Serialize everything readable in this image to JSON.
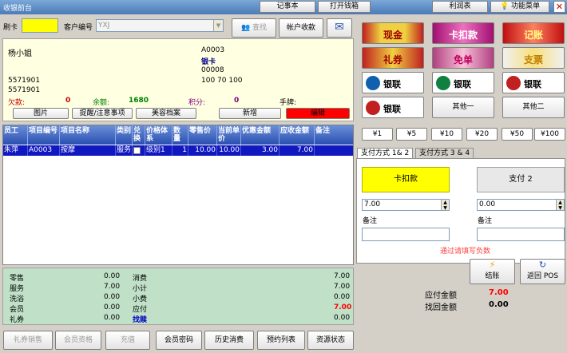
{
  "window": {
    "title": "收银前台"
  },
  "topbar": {
    "notepad": "记事本",
    "open_drawer": "打开钱箱",
    "profit_table": "利润表",
    "function_menu": "功能菜单"
  },
  "card": {
    "label": "刷卡",
    "value": "",
    "customer_label": "客户编号",
    "customer_value": "YXJ",
    "search": "查找",
    "account_pay": "帐户收款"
  },
  "member": {
    "name": "杨小姐",
    "code": "A0003",
    "card_type": "银卡",
    "number": "00008",
    "phone1": "5571901",
    "phone2": "5571901",
    "stats_line": "100   70   100",
    "debt_label": "欠款:",
    "debt_value": "0",
    "balance_label": "余额:",
    "balance_value": "1680",
    "points_label": "积分:",
    "points_value": "0",
    "hand_label": "手牌:",
    "hand_value": ""
  },
  "member_buttons": {
    "photo": "图片",
    "reminder": "提醒/注意事项",
    "beauty": "美容档案",
    "add": "新增",
    "edit": "编辑"
  },
  "table": {
    "headers": [
      "员工",
      "项目编号",
      "项目名称",
      "类别",
      "兑换",
      "价格体系",
      "数量",
      "零售价",
      "当前单价",
      "优惠金额",
      "应收金额",
      "备注"
    ],
    "rows": [
      {
        "employee": "朱萍",
        "code": "A0003",
        "name": "按摩",
        "category": "服务",
        "exchange": "",
        "price_system": "级别1",
        "qty": "1",
        "retail": "10.00",
        "unit": "10.00",
        "discount": "3.00",
        "receivable": "7.00",
        "remark": ""
      }
    ]
  },
  "summary": {
    "left": [
      {
        "label": "零售",
        "value": "0.00"
      },
      {
        "label": "服务",
        "value": "7.00"
      },
      {
        "label": "洗浴",
        "value": "0.00"
      },
      {
        "label": "会员",
        "value": "0.00"
      },
      {
        "label": "礼券",
        "value": "0.00"
      }
    ],
    "right": [
      {
        "label": "消费",
        "value": "7.00"
      },
      {
        "label": "小计",
        "value": "7.00"
      },
      {
        "label": "小费",
        "value": "0.00"
      },
      {
        "label": "应付",
        "value": "7.00"
      },
      {
        "label": "找赎",
        "value": "0.00"
      }
    ]
  },
  "bottom_buttons": {
    "coupon_sale": "礼券销售",
    "member_qual": "会员资格",
    "recharge": "充值",
    "member_pwd": "会员密码",
    "history": "历史消费",
    "booking": "预约列表",
    "resource": "资源状态"
  },
  "payment_methods": {
    "cash": "现金",
    "card_deduct": "卡扣款",
    "on_account": "记账",
    "coupon": "礼券",
    "free": "免单",
    "cheque": "支票",
    "unionpay": "银联",
    "other1": "其他一",
    "other2": "其他二"
  },
  "cash_buttons": [
    "¥1",
    "¥5",
    "¥10",
    "¥20",
    "¥50",
    "¥100"
  ],
  "pay_tabs": [
    "支付方式 1& 2",
    "支付方式 3 & 4"
  ],
  "pay": {
    "method1": "卡扣款",
    "method2": "支付 2",
    "amount1": "7.00",
    "amount2": "0.00",
    "remark_label": "备注",
    "remark1": "",
    "remark2": "",
    "hint": "通过请填写负数"
  },
  "actions": {
    "checkout": "结账",
    "back_pos": "返回 POS"
  },
  "totals": {
    "payable_label": "应付金额",
    "payable_value": "7.00",
    "change_label": "找回金额",
    "change_value": "0.00"
  },
  "colors": {
    "accent_yellow": "#ffff00",
    "edit_red": "#ff0000",
    "grid_select": "#1018c0",
    "debt_red": "#c00000",
    "balance_green": "#008000",
    "points_purple": "#800080"
  }
}
